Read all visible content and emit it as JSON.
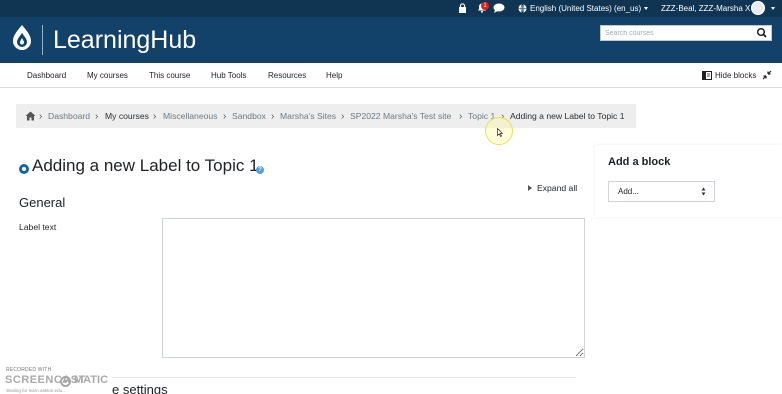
{
  "topbar": {
    "language": "English (United States) (en_us)",
    "user_name": "ZZZ-Beal, ZZZ-Marsha X",
    "notification_count": "1"
  },
  "brand": {
    "site_name": "LearningHub",
    "search_placeholder": "Search courses"
  },
  "nav": {
    "items": [
      "Dashboard",
      "My courses",
      "This course",
      "Hub Tools",
      "Resources",
      "Help"
    ],
    "hide_blocks": "Hide blocks"
  },
  "breadcrumb": {
    "items": [
      "Dashboard",
      "My courses",
      "Miscellaneous",
      "Sandbox",
      "Marsha's Sites",
      "SP2022 Marsha's Test site",
      "Topic 1"
    ],
    "current": "Adding a new Label to Topic 1"
  },
  "main": {
    "title": "Adding a new Label to Topic 1",
    "help_icon": "?",
    "expand_all": "Expand all",
    "section_general": "General",
    "label_text_label": "Label text",
    "label_text_value": "",
    "next_section_partial": "e settings"
  },
  "blocks": {
    "title": "Add a block",
    "select_value": "Add..."
  },
  "watermark": {
    "line1": "RECORDED WITH",
    "brand_left": "SCREENCAST",
    "brand_right": "MATIC",
    "line3": "Waiting for learn.oakton.edu..."
  },
  "colors": {
    "topbar": "#0f3552",
    "brandbar": "#12426a",
    "breadcrumb_bg": "#eeeeee",
    "page_icon": "#1464b4"
  },
  "icons": [
    "lock-icon",
    "bell-icon",
    "chat-icon",
    "globe-icon",
    "logo-icon",
    "search-icon",
    "collapse-icon",
    "home-icon",
    "help-icon",
    "select-arrows-icon",
    "expand-arrow-icon"
  ]
}
